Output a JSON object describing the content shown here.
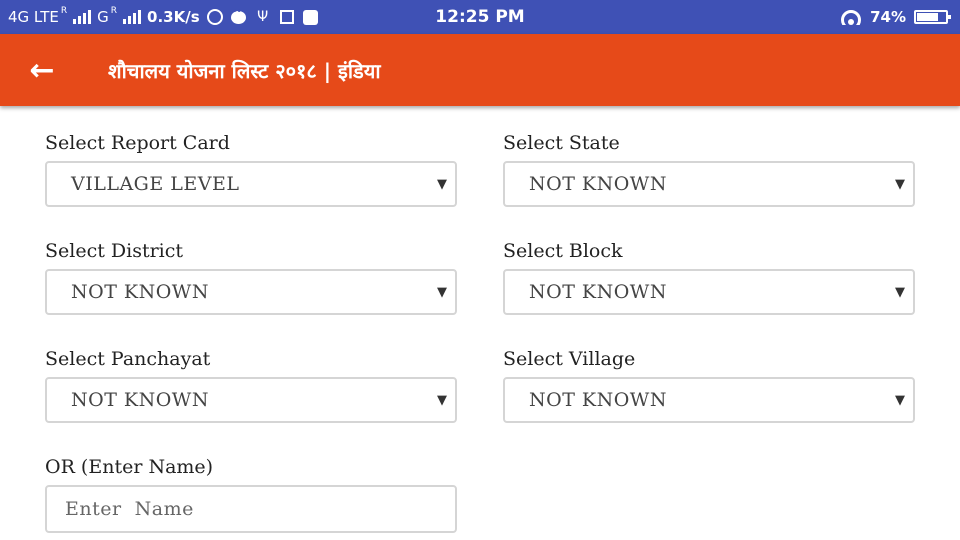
{
  "status_bar": {
    "network1": "4G LTE",
    "network2": "G",
    "roam": "R",
    "speed": "0.3K/s",
    "time": "12:25 PM",
    "battery": "74%",
    "icons": [
      "whatsapp-icon",
      "chat-icon",
      "usb-icon",
      "screenshot-icon",
      "app-icon",
      "wifi-icon",
      "battery-icon"
    ]
  },
  "app_bar": {
    "back_icon": "←",
    "title": "शौचालय योजना लिस्ट २०१८ | इंडिया",
    "color": "#e64a19"
  },
  "form": {
    "report_card": {
      "label": "Select Report Card",
      "value": "VILLAGE LEVEL"
    },
    "state": {
      "label": "Select State",
      "value": "NOT KNOWN"
    },
    "district": {
      "label": "Select District",
      "value": "NOT KNOWN"
    },
    "block": {
      "label": "Select Block",
      "value": "NOT KNOWN"
    },
    "panchayat": {
      "label": "Select Panchayat",
      "value": "NOT KNOWN"
    },
    "village": {
      "label": "Select Village",
      "value": "NOT KNOWN"
    },
    "name": {
      "label": "OR (Enter Name)",
      "placeholder": "Enter  Name"
    },
    "caret": "▼"
  }
}
